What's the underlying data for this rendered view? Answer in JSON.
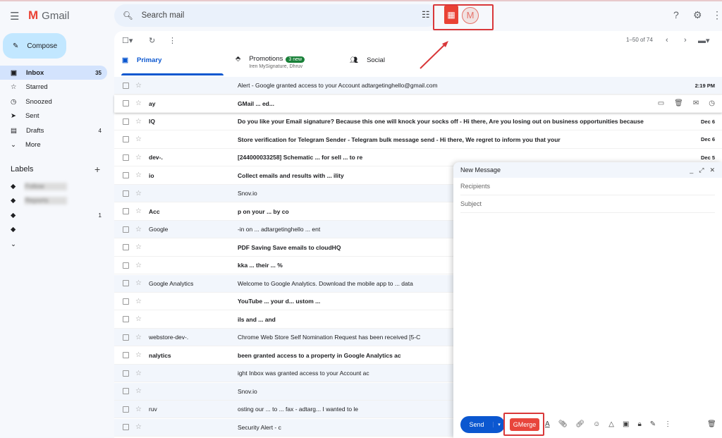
{
  "app": {
    "name": "Gmail"
  },
  "search": {
    "placeholder": "Search mail"
  },
  "compose_button": "Compose",
  "nav": [
    {
      "label": "Inbox",
      "count": "35",
      "icon": "inbox-icon"
    },
    {
      "label": "Starred",
      "count": "",
      "icon": "star-icon"
    },
    {
      "label": "Snoozed",
      "count": "",
      "icon": "clock-icon"
    },
    {
      "label": "Sent",
      "count": "",
      "icon": "send-icon"
    },
    {
      "label": "Drafts",
      "count": "4",
      "icon": "file-icon"
    },
    {
      "label": "More",
      "count": "",
      "icon": "chevron-down-icon"
    }
  ],
  "labels": {
    "title": "Labels",
    "items": [
      {
        "label": "Follow",
        "count": ""
      },
      {
        "label": "Reports",
        "count": ""
      },
      {
        "label": "",
        "count": "1"
      },
      {
        "label": "",
        "count": ""
      },
      {
        "label": "",
        "count": ""
      }
    ]
  },
  "pagination": "1–50 of 74",
  "tabs": {
    "primary": "Primary",
    "promotions": "Promotions",
    "promotions_badge": "3 new",
    "promotions_sub": "Iren MySignature, Dhruv",
    "social": "Social"
  },
  "emails": [
    {
      "sender": "",
      "subject": "Alert - Google granted access to your Account adtargetinghello@gmail.com",
      "date": "2:19 PM",
      "unread": false
    },
    {
      "sender": "ay",
      "subject": "GMail ... ed...",
      "date": "",
      "unread": true
    },
    {
      "sender": "IQ",
      "subject": "Do you like your Email signature? Because this one will knock your socks off - Hi there, Are you losing out on business opportunities because",
      "date": "Dec 6",
      "unread": true
    },
    {
      "sender": "",
      "subject": "Store verification for Telegram Sender - Telegram bulk message send - Hi there, We regret to inform you that your",
      "date": "Dec 6",
      "unread": true
    },
    {
      "sender": "dev-.",
      "subject": "[244000033258] Schematic ... for sell ... to re",
      "date": "Dec 5",
      "unread": true
    },
    {
      "sender": "io",
      "subject": "Collect emails and results with ... ility",
      "date": "",
      "unread": true
    },
    {
      "sender": "",
      "subject": "Snov.io",
      "date": "",
      "unread": false
    },
    {
      "sender": "Acc",
      "subject": "p on your ... by co",
      "date": "",
      "unread": true
    },
    {
      "sender": "Google",
      "subject": "-in on ... adtargetinghello ... ent",
      "date": "",
      "unread": false
    },
    {
      "sender": "",
      "subject": "PDF Saving Save emails to cloudHQ",
      "date": "",
      "unread": true
    },
    {
      "sender": "",
      "subject": "kka ... their ... %",
      "date": "",
      "unread": true
    },
    {
      "sender": "Google Analytics",
      "subject": "Welcome to Google Analytics. Download the mobile app to ... data",
      "date": "",
      "unread": false
    },
    {
      "sender": "",
      "subject": "YouTube ... your d... ustom ...",
      "date": "",
      "unread": true
    },
    {
      "sender": "",
      "subject": "ils and ... and",
      "date": "",
      "unread": true
    },
    {
      "sender": "webstore-dev-.",
      "subject": "Chrome Web Store Self Nomination Request has been received [5-C",
      "date": "",
      "unread": false
    },
    {
      "sender": "nalytics",
      "subject": "been granted access to a property in Google Analytics ac",
      "date": "",
      "unread": true
    },
    {
      "sender": "",
      "subject": "ight Inbox was granted access to your Account ac",
      "date": "",
      "unread": false
    },
    {
      "sender": "",
      "subject": "Snov.io",
      "date": "",
      "unread": false
    },
    {
      "sender": "ruv",
      "subject": "osting our ... to ... fax - adtarg... I wanted to le",
      "date": "",
      "unread": false
    },
    {
      "sender": "",
      "subject": "Security Alert - c",
      "date": "",
      "unread": false
    }
  ],
  "compose": {
    "title": "New Message",
    "recipients": "Recipients",
    "subject": "Subject",
    "send": "Send",
    "gmerge": "GMerge"
  },
  "colors": {
    "accent": "#0b57d0",
    "gmerge": "#e8453c",
    "highlight": "#d9383a"
  }
}
